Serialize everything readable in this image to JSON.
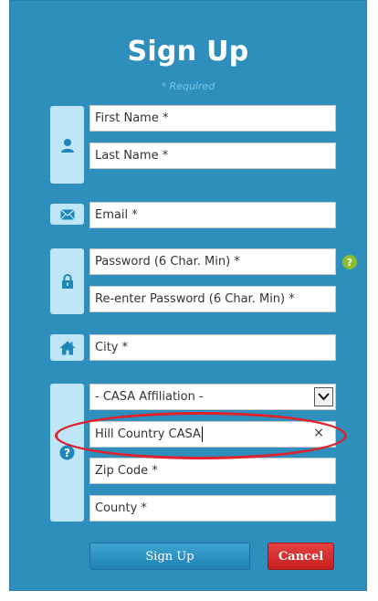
{
  "form": {
    "title": "Sign Up",
    "required_note": "* Required"
  },
  "fields": {
    "first_name": "First Name *",
    "last_name": "Last Name *",
    "email": "Email *",
    "password": "Password (6 Char. Min) *",
    "reenter_password": "Re-enter Password (6 Char. Min) *",
    "city": "City *",
    "casa_affiliation": "- CASA Affiliation -",
    "casa_search_value": "Hill Country CASA",
    "zip_code": "Zip Code *",
    "county": "County *"
  },
  "help_glyph": "?",
  "clear_glyph": "×",
  "buttons": {
    "sign_up": "Sign Up",
    "cancel": "Cancel"
  },
  "icons": {
    "name": "user-icon",
    "email": "envelope-icon",
    "password": "lock-icon",
    "city": "home-icon",
    "casa": "question-icon"
  },
  "colors": {
    "panel": "#2e8fbd",
    "icon_box": "#bfe6f7",
    "icon": "#1f86b8",
    "help": "#8bbd2d",
    "cancel": "#d42b2b",
    "highlight": "#e0202a"
  }
}
